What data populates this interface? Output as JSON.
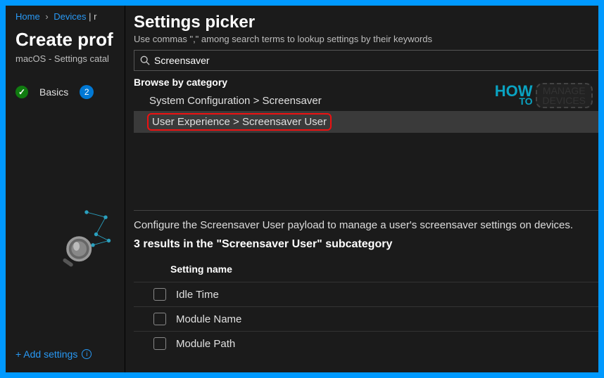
{
  "breadcrumb": {
    "home": "Home",
    "devices": "Devices",
    "tail": "| r"
  },
  "left": {
    "title": "Create prof",
    "subtitle": "macOS - Settings catal",
    "step1_label": "Basics",
    "step2_num": "2",
    "add_settings": "+ Add settings"
  },
  "picker": {
    "title": "Settings picker",
    "help": "Use commas \",\" among search terms to lookup settings by their keywords",
    "search_value": "Screensaver",
    "browse_label": "Browse by category",
    "categories": {
      "c0": "System Configuration > Screensaver",
      "c1": "User Experience > Screensaver User"
    },
    "description": "Configure the Screensaver User payload to manage a user's screensaver settings on devices.",
    "results_head": "3 results in the \"Screensaver User\" subcategory",
    "col_head": "Setting name",
    "settings": {
      "s0": "Idle Time",
      "s1": "Module Name",
      "s2": "Module Path"
    }
  },
  "watermark": {
    "how": "HOW",
    "to": "TO",
    "manage": "MANAGE",
    "devices": "DEVICES"
  }
}
